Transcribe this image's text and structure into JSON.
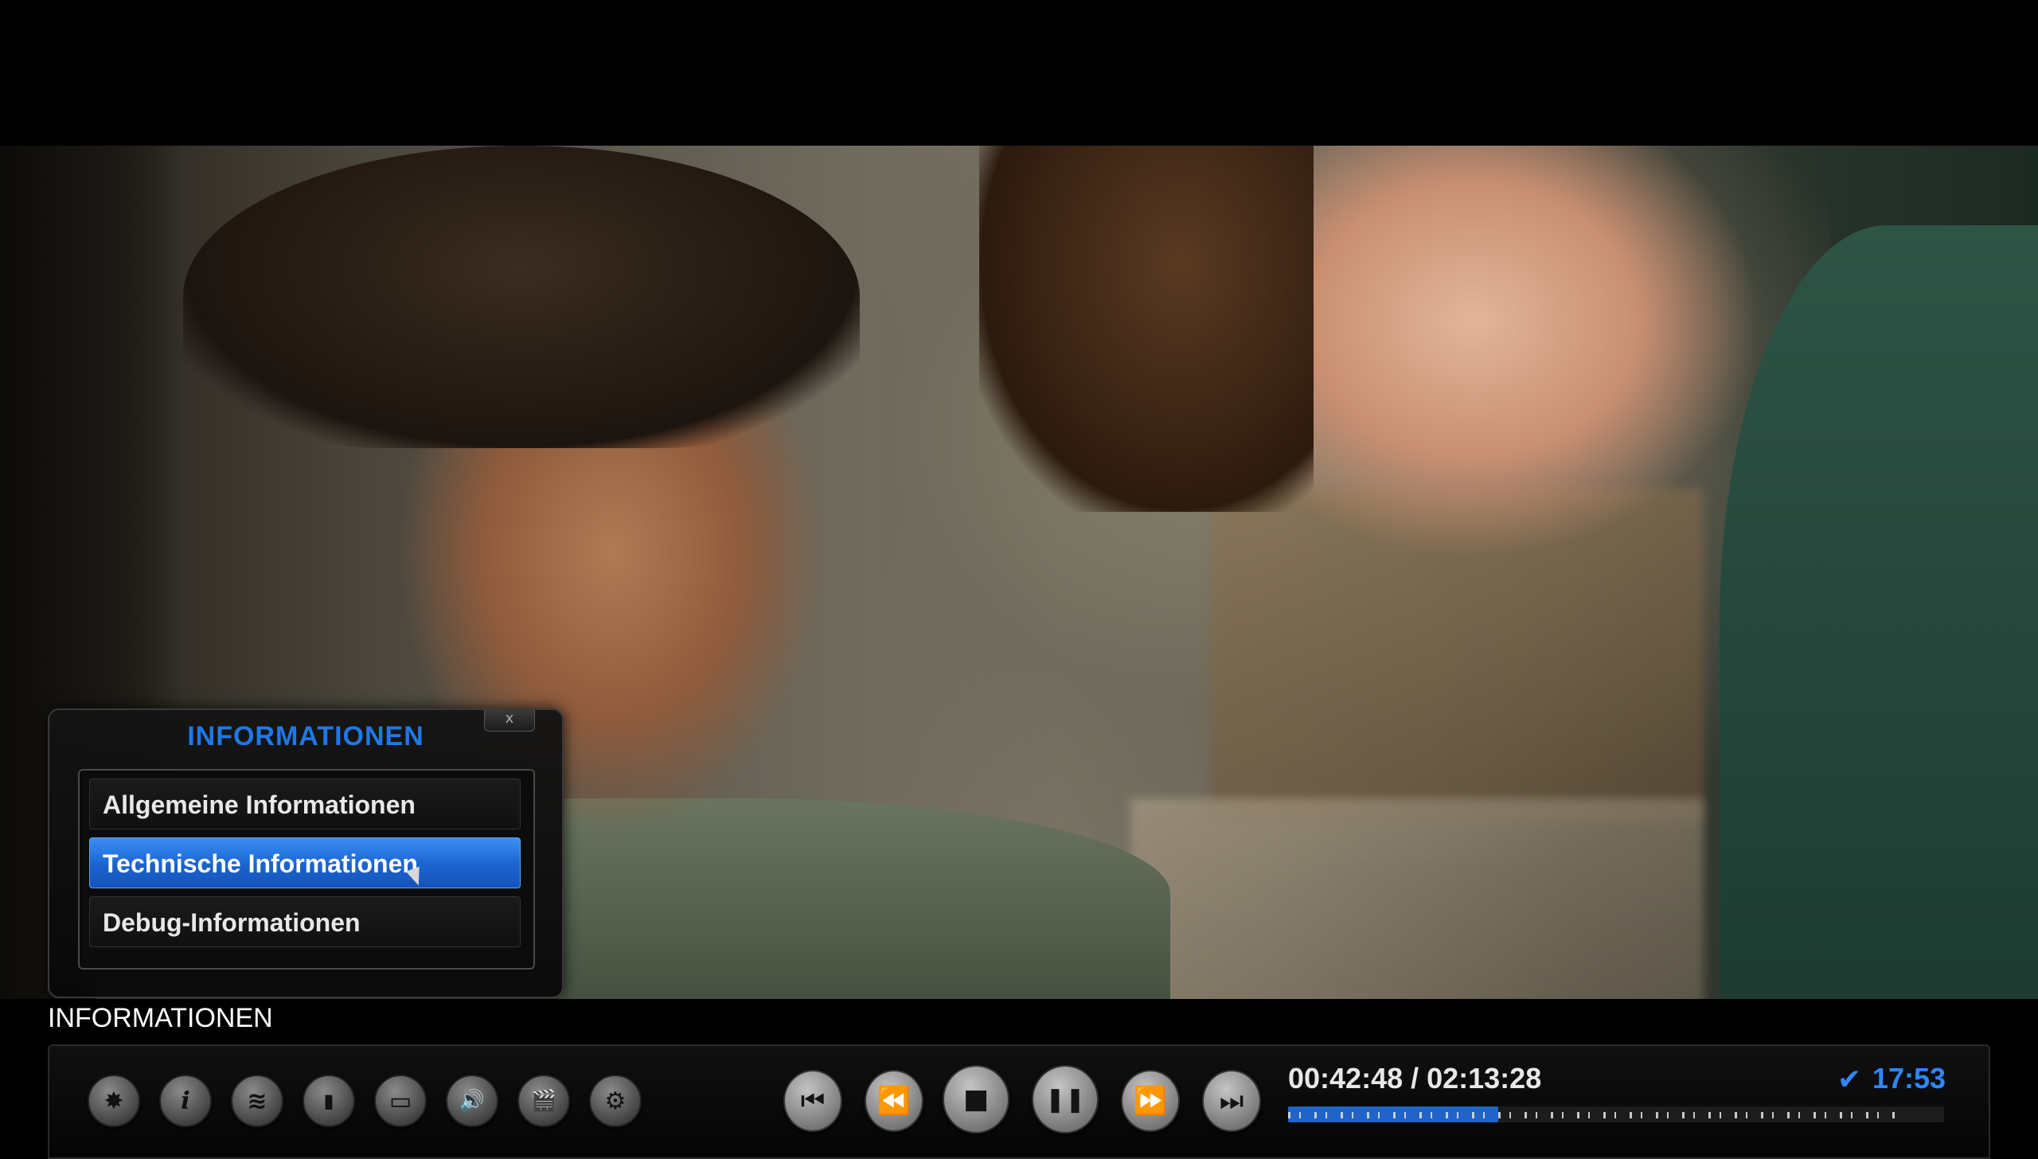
{
  "popup": {
    "title": "INFORMATIONEN",
    "close_label": "x",
    "items": [
      {
        "label": "Allgemeine Informationen",
        "selected": false
      },
      {
        "label": "Technische Informationen",
        "selected": true
      },
      {
        "label": "Debug-Informationen",
        "selected": false
      }
    ]
  },
  "bottom_label": "INFORMATIONEN",
  "osd": {
    "left_controls": [
      {
        "name": "visualization-off-icon",
        "glyph": "✸"
      },
      {
        "name": "info-icon",
        "glyph": "i"
      },
      {
        "name": "layers-icon",
        "glyph": "≋"
      },
      {
        "name": "bookmark-icon",
        "glyph": "▮"
      },
      {
        "name": "subtitles-icon",
        "glyph": "▭"
      },
      {
        "name": "audio-icon",
        "glyph": "🔊"
      },
      {
        "name": "video-icon",
        "glyph": "🎬"
      },
      {
        "name": "settings-icon",
        "glyph": "⚙"
      }
    ],
    "transport": [
      {
        "name": "skip-back-icon",
        "glyph": "⏮"
      },
      {
        "name": "rewind-icon",
        "glyph": "⏪"
      },
      {
        "name": "stop-icon",
        "glyph": "■"
      },
      {
        "name": "pause-icon",
        "glyph": "❚❚"
      },
      {
        "name": "fast-forward-icon",
        "glyph": "⏩"
      },
      {
        "name": "skip-forward-icon",
        "glyph": "⏭"
      }
    ],
    "time": "00:42:48 / 02:13:28",
    "clock": "17:53",
    "check_glyph": "✔",
    "progress": 0.32,
    "accent_color": "#2f86ff"
  }
}
